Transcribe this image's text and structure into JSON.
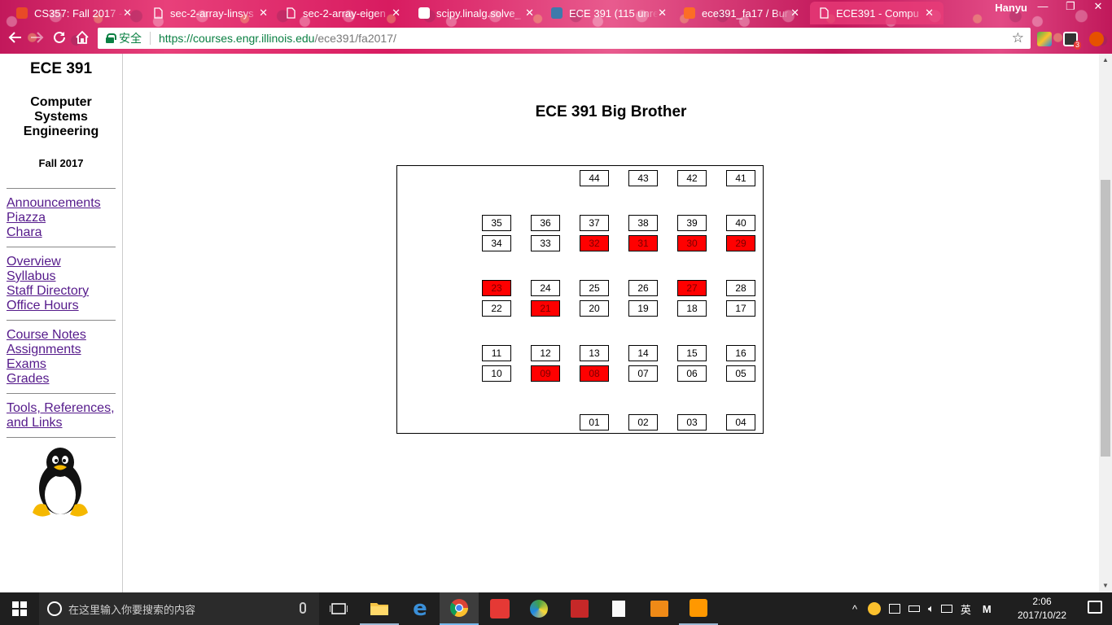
{
  "browser": {
    "tabs": [
      {
        "title": "CS357: Fall 2017 -",
        "icon": "illinois-logo-icon",
        "active": false
      },
      {
        "title": "sec-2-array-linsys",
        "icon": "document-icon",
        "active": false
      },
      {
        "title": "sec-2-array-eigen",
        "icon": "document-icon",
        "active": false
      },
      {
        "title": "scipy.linalg.solve_",
        "icon": "scipy-logo-icon",
        "active": false
      },
      {
        "title": "ECE 391 (115 unre",
        "icon": "piazza-logo-icon",
        "active": false
      },
      {
        "title": "ece391_fa17 / Bur",
        "icon": "gitlab-logo-icon",
        "active": false
      },
      {
        "title": "ECE391 - Compu",
        "icon": "document-icon",
        "active": true
      }
    ],
    "close_glyph": "✕",
    "profile_name": "Hanyu",
    "window_controls": {
      "minimize": "—",
      "restore": "❐",
      "close": "✕"
    },
    "security_label": "安全",
    "url_host": "https://courses.engr.illinois.edu",
    "url_path": "/ece391/fa2017/",
    "extension_badge": "3"
  },
  "sidebar": {
    "course_code": "ECE 391",
    "course_name_lines": [
      "Computer",
      "Systems",
      "Engineering"
    ],
    "term": "Fall 2017",
    "link_groups": [
      [
        "Announcements",
        "Piazza",
        "Chara"
      ],
      [
        "Overview",
        "Syllabus",
        "Staff Directory",
        "Office Hours"
      ],
      [
        "Course Notes",
        "Assignments",
        "Exams",
        "Grades"
      ],
      [
        "Tools, References,",
        "and Links"
      ]
    ]
  },
  "main": {
    "title": "ECE 391 Big Brother",
    "seat_rows": [
      {
        "seats": [
          "44",
          "43",
          "42",
          "41"
        ],
        "taken": []
      },
      {
        "seats": [
          "35",
          "36",
          "37",
          "38",
          "39",
          "40"
        ],
        "taken": []
      },
      {
        "seats": [
          "34",
          "33",
          "32",
          "31",
          "30",
          "29"
        ],
        "taken": [
          "32",
          "31",
          "30",
          "29"
        ]
      },
      {
        "seats": [
          "23",
          "24",
          "25",
          "26",
          "27",
          "28"
        ],
        "taken": [
          "23",
          "27"
        ]
      },
      {
        "seats": [
          "22",
          "21",
          "20",
          "19",
          "18",
          "17"
        ],
        "taken": [
          "21"
        ]
      },
      {
        "seats": [
          "11",
          "12",
          "13",
          "14",
          "15",
          "16"
        ],
        "taken": []
      },
      {
        "seats": [
          "10",
          "09",
          "08",
          "07",
          "06",
          "05"
        ],
        "taken": [
          "09",
          "08"
        ]
      },
      {
        "seats": [
          "01",
          "02",
          "03",
          "04"
        ],
        "taken": []
      }
    ],
    "taken_color": "#ff0000"
  },
  "taskbar": {
    "search_placeholder": "在这里输入你要搜索的内容",
    "apps": [
      "task-view-icon",
      "file-explorer-icon",
      "edge-icon",
      "chrome-icon",
      "youdao-icon",
      "qq-browser-icon",
      "acrobat-icon",
      "notepad-icon",
      "media-player-icon",
      "sublime-text-icon"
    ],
    "ime_label": "英",
    "ime_mode": "M",
    "time": "2:06",
    "date": "2017/10/22"
  }
}
